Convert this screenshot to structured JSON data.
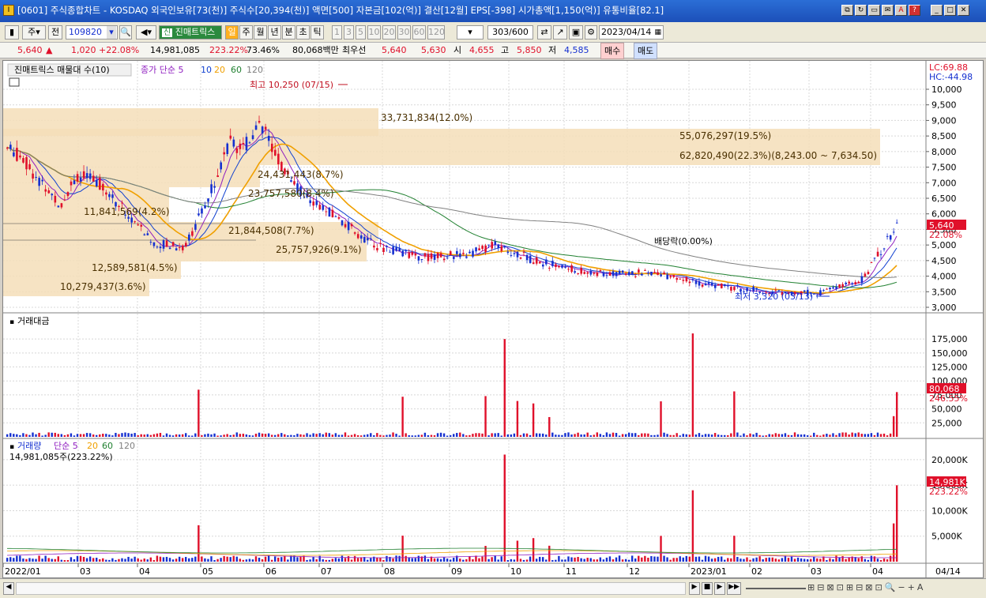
{
  "window": {
    "title": "[0601] 주식종합차트 - KOSDAQ 외국인보유[73(천)] 주식수[20,394(천)] 액면[500] 자본금[102(억)] 결산[12월] EPS[-398] 시가총액[1,150(억)] 유통비율[82.1]",
    "app_icon": "I",
    "buttons": [
      "restore-icon",
      "refresh-icon",
      "layout-icon",
      "mail-icon",
      "font-icon",
      "help-icon",
      "minimize-icon",
      "maximize-icon",
      "close-icon"
    ]
  },
  "toolbar": {
    "period_type": "주",
    "prev_label": "전",
    "code": "109820",
    "stock_name": "진매트릭스",
    "period_buttons": [
      "일",
      "주",
      "월",
      "년",
      "분",
      "초",
      "틱"
    ],
    "minute_buttons": [
      "1",
      "3",
      "5",
      "10",
      "20",
      "30",
      "60",
      "120"
    ],
    "count": "303",
    "count_total": "/600",
    "date": "2023/04/14"
  },
  "quote": {
    "price": "5,640",
    "change_arrow": "▲",
    "change": "1,020",
    "change_pct": "+22.08%",
    "volume": "14,981,085",
    "volume_pct": "223.22%",
    "ratio": "73.46%",
    "amount": "80,068백만",
    "best_label": "최우선",
    "ask": "5,640",
    "bid": "5,630",
    "open_label": "시",
    "open": "4,655",
    "high_label": "고",
    "high": "5,850",
    "low_label": "저",
    "low": "4,585",
    "buy_label": "매수",
    "sell_label": "매도"
  },
  "price_panel": {
    "legend_title": "진매트릭스 매물대 수(10)",
    "ma_label": "종가 단순 5",
    "ma_periods": [
      "10",
      "20",
      "60",
      "120"
    ],
    "ma_colors": {
      "5": "#9020c0",
      "10": "#1040d0",
      "20": "#f0a000",
      "60": "#208030",
      "120": "#808080"
    },
    "lc": "LC:69.88",
    "hc": "HC:-44.98",
    "high_marker": "최고 10,250 (07/15)",
    "low_marker": "최저 3,320 (03/13)",
    "dividend_marker": "배당락(0.00%)",
    "current_price": "5,640",
    "current_pct": "22.08%",
    "y_labels": [
      "10,000",
      "9,500",
      "9,000",
      "8,500",
      "8,000",
      "7,500",
      "7,000",
      "6,500",
      "6,000",
      "5,500",
      "5,000",
      "4,500",
      "4,000",
      "3,500",
      "3,000"
    ],
    "volume_profile": [
      "33,731,834(12.0%)",
      "55,076,297(19.5%)",
      "62,820,490(22.3%)(8,243.00 ~ 7,634.50)",
      "24,431,443(8.7%)",
      "23,757,580(8.4%)",
      "11,841,569(4.2%)",
      "21,844,508(7.7%)",
      "25,757,926(9.1%)",
      "12,589,581(4.5%)",
      "10,279,437(3.6%)"
    ]
  },
  "amount_panel": {
    "title": "거래대금",
    "y_labels": [
      "175,000",
      "150,000",
      "125,000",
      "100,000",
      "75,000",
      "50,000",
      "25,000"
    ],
    "current": "80,068",
    "current_pct": "246.55%"
  },
  "volume_panel": {
    "title": "거래량",
    "ma_label": "단순 5",
    "ma_periods": [
      "20",
      "60",
      "120"
    ],
    "current_text": "14,981,085주(223.22%)",
    "y_labels": [
      "20,000K",
      "15,000K",
      "10,000K",
      "5,000K"
    ],
    "current": "14,981K",
    "current_pct": "223.22%"
  },
  "x_axis": [
    "2022/01",
    "03",
    "04",
    "05",
    "06",
    "07",
    "08",
    "09",
    "10",
    "11",
    "12",
    "2023/01",
    "02",
    "03",
    "04",
    "04/14"
  ],
  "colors": {
    "up": "#e0102a",
    "down": "#1530d0",
    "profile": "#f5deb8"
  }
}
